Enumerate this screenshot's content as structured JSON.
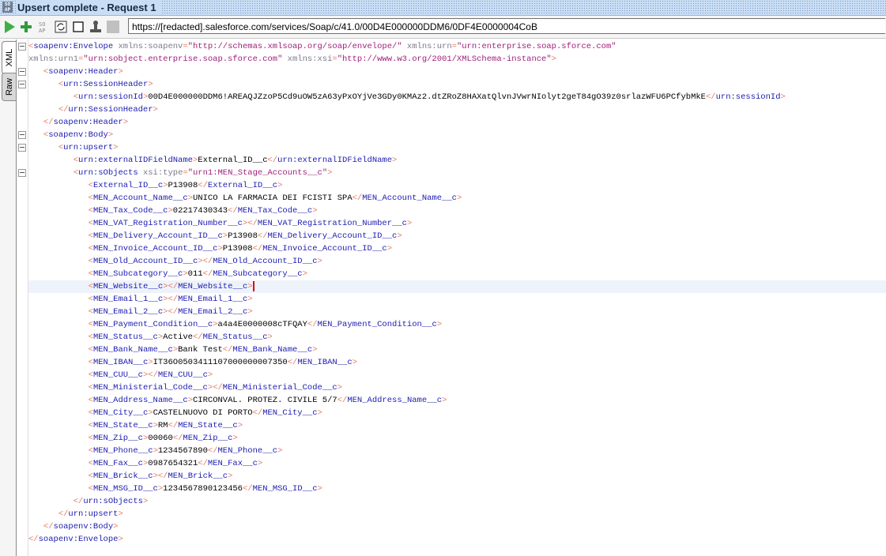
{
  "window": {
    "title": "Upsert complete - Request 1",
    "app_icon": "soap-icon"
  },
  "toolbar": {
    "buttons": [
      "run-icon",
      "add-icon",
      "soap-icon",
      "refresh-icon",
      "stop-icon",
      "stamp-icon",
      "disabled-icon"
    ],
    "url": "https://[redacted].salesforce.com/services/Soap/c/41.0/00D4E000000DDM6/0DF4E0000004CoB"
  },
  "view_tabs": {
    "xml": "XML",
    "raw": "Raw"
  },
  "xml": {
    "lines": [
      {
        "indent": 0,
        "fold": true,
        "parts": [
          [
            "b",
            "<"
          ],
          [
            "t",
            "soapenv:Envelope"
          ],
          [
            "a",
            " xmlns:soapenv"
          ],
          [
            "b",
            "="
          ],
          [
            "v",
            "\"http://schemas.xmlsoap.org/soap/envelope/\""
          ],
          [
            "a",
            " xmlns:urn"
          ],
          [
            "b",
            "="
          ],
          [
            "v",
            "\"urn:enterprise.soap.sforce.com\""
          ]
        ]
      },
      {
        "indent": 0,
        "parts": [
          [
            "a",
            "xmlns:urn1"
          ],
          [
            "b",
            "="
          ],
          [
            "v",
            "\"urn:sobject.enterprise.soap.sforce.com\""
          ],
          [
            "a",
            " xmlns:xsi"
          ],
          [
            "b",
            "="
          ],
          [
            "v",
            "\"http://www.w3.org/2001/XMLSchema-instance\""
          ],
          [
            "b",
            ">"
          ]
        ]
      },
      {
        "indent": 1,
        "fold": true,
        "parts": [
          [
            "b",
            "<"
          ],
          [
            "t",
            "soapenv:Header"
          ],
          [
            "b",
            ">"
          ]
        ]
      },
      {
        "indent": 2,
        "fold": true,
        "parts": [
          [
            "b",
            "<"
          ],
          [
            "t",
            "urn:SessionHeader"
          ],
          [
            "b",
            ">"
          ]
        ]
      },
      {
        "indent": 3,
        "parts": [
          [
            "b",
            "<"
          ],
          [
            "t",
            "urn:sessionId"
          ],
          [
            "b",
            ">"
          ],
          [
            "x",
            "00D4E000000DDM6!AREAQJZzoP5Cd9uOW5zA63yPxOYjVe3GDy0KMAz2.dtZRoZ8HAXatQlvnJVwrNIolyt2geT84gO39z0srlazWFU6PCfybMkE"
          ],
          [
            "b",
            "</"
          ],
          [
            "t",
            "urn:sessionId"
          ],
          [
            "b",
            ">"
          ]
        ]
      },
      {
        "indent": 2,
        "parts": [
          [
            "b",
            "</"
          ],
          [
            "t",
            "urn:SessionHeader"
          ],
          [
            "b",
            ">"
          ]
        ]
      },
      {
        "indent": 1,
        "parts": [
          [
            "b",
            "</"
          ],
          [
            "t",
            "soapenv:Header"
          ],
          [
            "b",
            ">"
          ]
        ]
      },
      {
        "indent": 1,
        "fold": true,
        "parts": [
          [
            "b",
            "<"
          ],
          [
            "t",
            "soapenv:Body"
          ],
          [
            "b",
            ">"
          ]
        ]
      },
      {
        "indent": 2,
        "fold": true,
        "parts": [
          [
            "b",
            "<"
          ],
          [
            "t",
            "urn:upsert"
          ],
          [
            "b",
            ">"
          ]
        ]
      },
      {
        "indent": 3,
        "parts": [
          [
            "b",
            "<"
          ],
          [
            "t",
            "urn:externalIDFieldName"
          ],
          [
            "b",
            ">"
          ],
          [
            "x",
            "External_ID__c"
          ],
          [
            "b",
            "</"
          ],
          [
            "t",
            "urn:externalIDFieldName"
          ],
          [
            "b",
            ">"
          ]
        ]
      },
      {
        "indent": 3,
        "fold": true,
        "parts": [
          [
            "b",
            "<"
          ],
          [
            "t",
            "urn:sObjects"
          ],
          [
            "a",
            " xsi:type"
          ],
          [
            "b",
            "="
          ],
          [
            "v",
            "\"urn1:MEN_Stage_Accounts__c\""
          ],
          [
            "b",
            ">"
          ]
        ]
      },
      {
        "indent": 4,
        "field": [
          "External_ID__c",
          "P13908"
        ]
      },
      {
        "indent": 4,
        "field": [
          "MEN_Account_Name__c",
          "UNICO LA FARMACIA DEI FCISTI SPA"
        ]
      },
      {
        "indent": 4,
        "field": [
          "MEN_Tax_Code__c",
          "02217430343"
        ]
      },
      {
        "indent": 4,
        "field": [
          "MEN_VAT_Registration_Number__c",
          ""
        ]
      },
      {
        "indent": 4,
        "field": [
          "MEN_Delivery_Account_ID__c",
          "P13908"
        ]
      },
      {
        "indent": 4,
        "field": [
          "MEN_Invoice_Account_ID__c",
          "P13908"
        ]
      },
      {
        "indent": 4,
        "field": [
          "MEN_Old_Account_ID__c",
          ""
        ]
      },
      {
        "indent": 4,
        "field": [
          "MEN_Subcategory__c",
          "011"
        ]
      },
      {
        "indent": 4,
        "field": [
          "MEN_Website__c",
          ""
        ],
        "current": true
      },
      {
        "indent": 4,
        "field": [
          "MEN_Email_1__c",
          ""
        ]
      },
      {
        "indent": 4,
        "field": [
          "MEN_Email_2__c",
          ""
        ]
      },
      {
        "indent": 4,
        "field": [
          "MEN_Payment_Condition__c",
          "a4a4E0000008cTFQAY"
        ]
      },
      {
        "indent": 4,
        "field": [
          "MEN_Status__c",
          "Active"
        ]
      },
      {
        "indent": 4,
        "field": [
          "MEN_Bank_Name__c",
          "Bank Test"
        ]
      },
      {
        "indent": 4,
        "field": [
          "MEN_IBAN__c",
          "IT36O0503411107000000007350"
        ]
      },
      {
        "indent": 4,
        "field": [
          "MEN_CUU__c",
          ""
        ]
      },
      {
        "indent": 4,
        "field": [
          "MEN_Ministerial_Code__c",
          ""
        ]
      },
      {
        "indent": 4,
        "field": [
          "MEN_Address_Name__c",
          "CIRCONVAL. PROTEZ. CIVILE 5/7"
        ]
      },
      {
        "indent": 4,
        "field": [
          "MEN_City__c",
          "CASTELNUOVO DI PORTO"
        ]
      },
      {
        "indent": 4,
        "field": [
          "MEN_State__c",
          "RM"
        ]
      },
      {
        "indent": 4,
        "field": [
          "MEN_Zip__c",
          "00060"
        ]
      },
      {
        "indent": 4,
        "field": [
          "MEN_Phone__c",
          "1234567890"
        ]
      },
      {
        "indent": 4,
        "field": [
          "MEN_Fax__c",
          "0987654321"
        ]
      },
      {
        "indent": 4,
        "field": [
          "MEN_Brick__c",
          ""
        ]
      },
      {
        "indent": 4,
        "field": [
          "MEN_MSG_ID__c",
          "1234567890123456"
        ]
      },
      {
        "indent": 3,
        "parts": [
          [
            "b",
            "</"
          ],
          [
            "t",
            "urn:sObjects"
          ],
          [
            "b",
            ">"
          ]
        ]
      },
      {
        "indent": 2,
        "parts": [
          [
            "b",
            "</"
          ],
          [
            "t",
            "urn:upsert"
          ],
          [
            "b",
            ">"
          ]
        ]
      },
      {
        "indent": 1,
        "parts": [
          [
            "b",
            "</"
          ],
          [
            "t",
            "soapenv:Body"
          ],
          [
            "b",
            ">"
          ]
        ]
      },
      {
        "indent": 0,
        "parts": [
          [
            "b",
            "</"
          ],
          [
            "t",
            "soapenv:Envelope"
          ],
          [
            "b",
            ">"
          ]
        ]
      }
    ]
  }
}
